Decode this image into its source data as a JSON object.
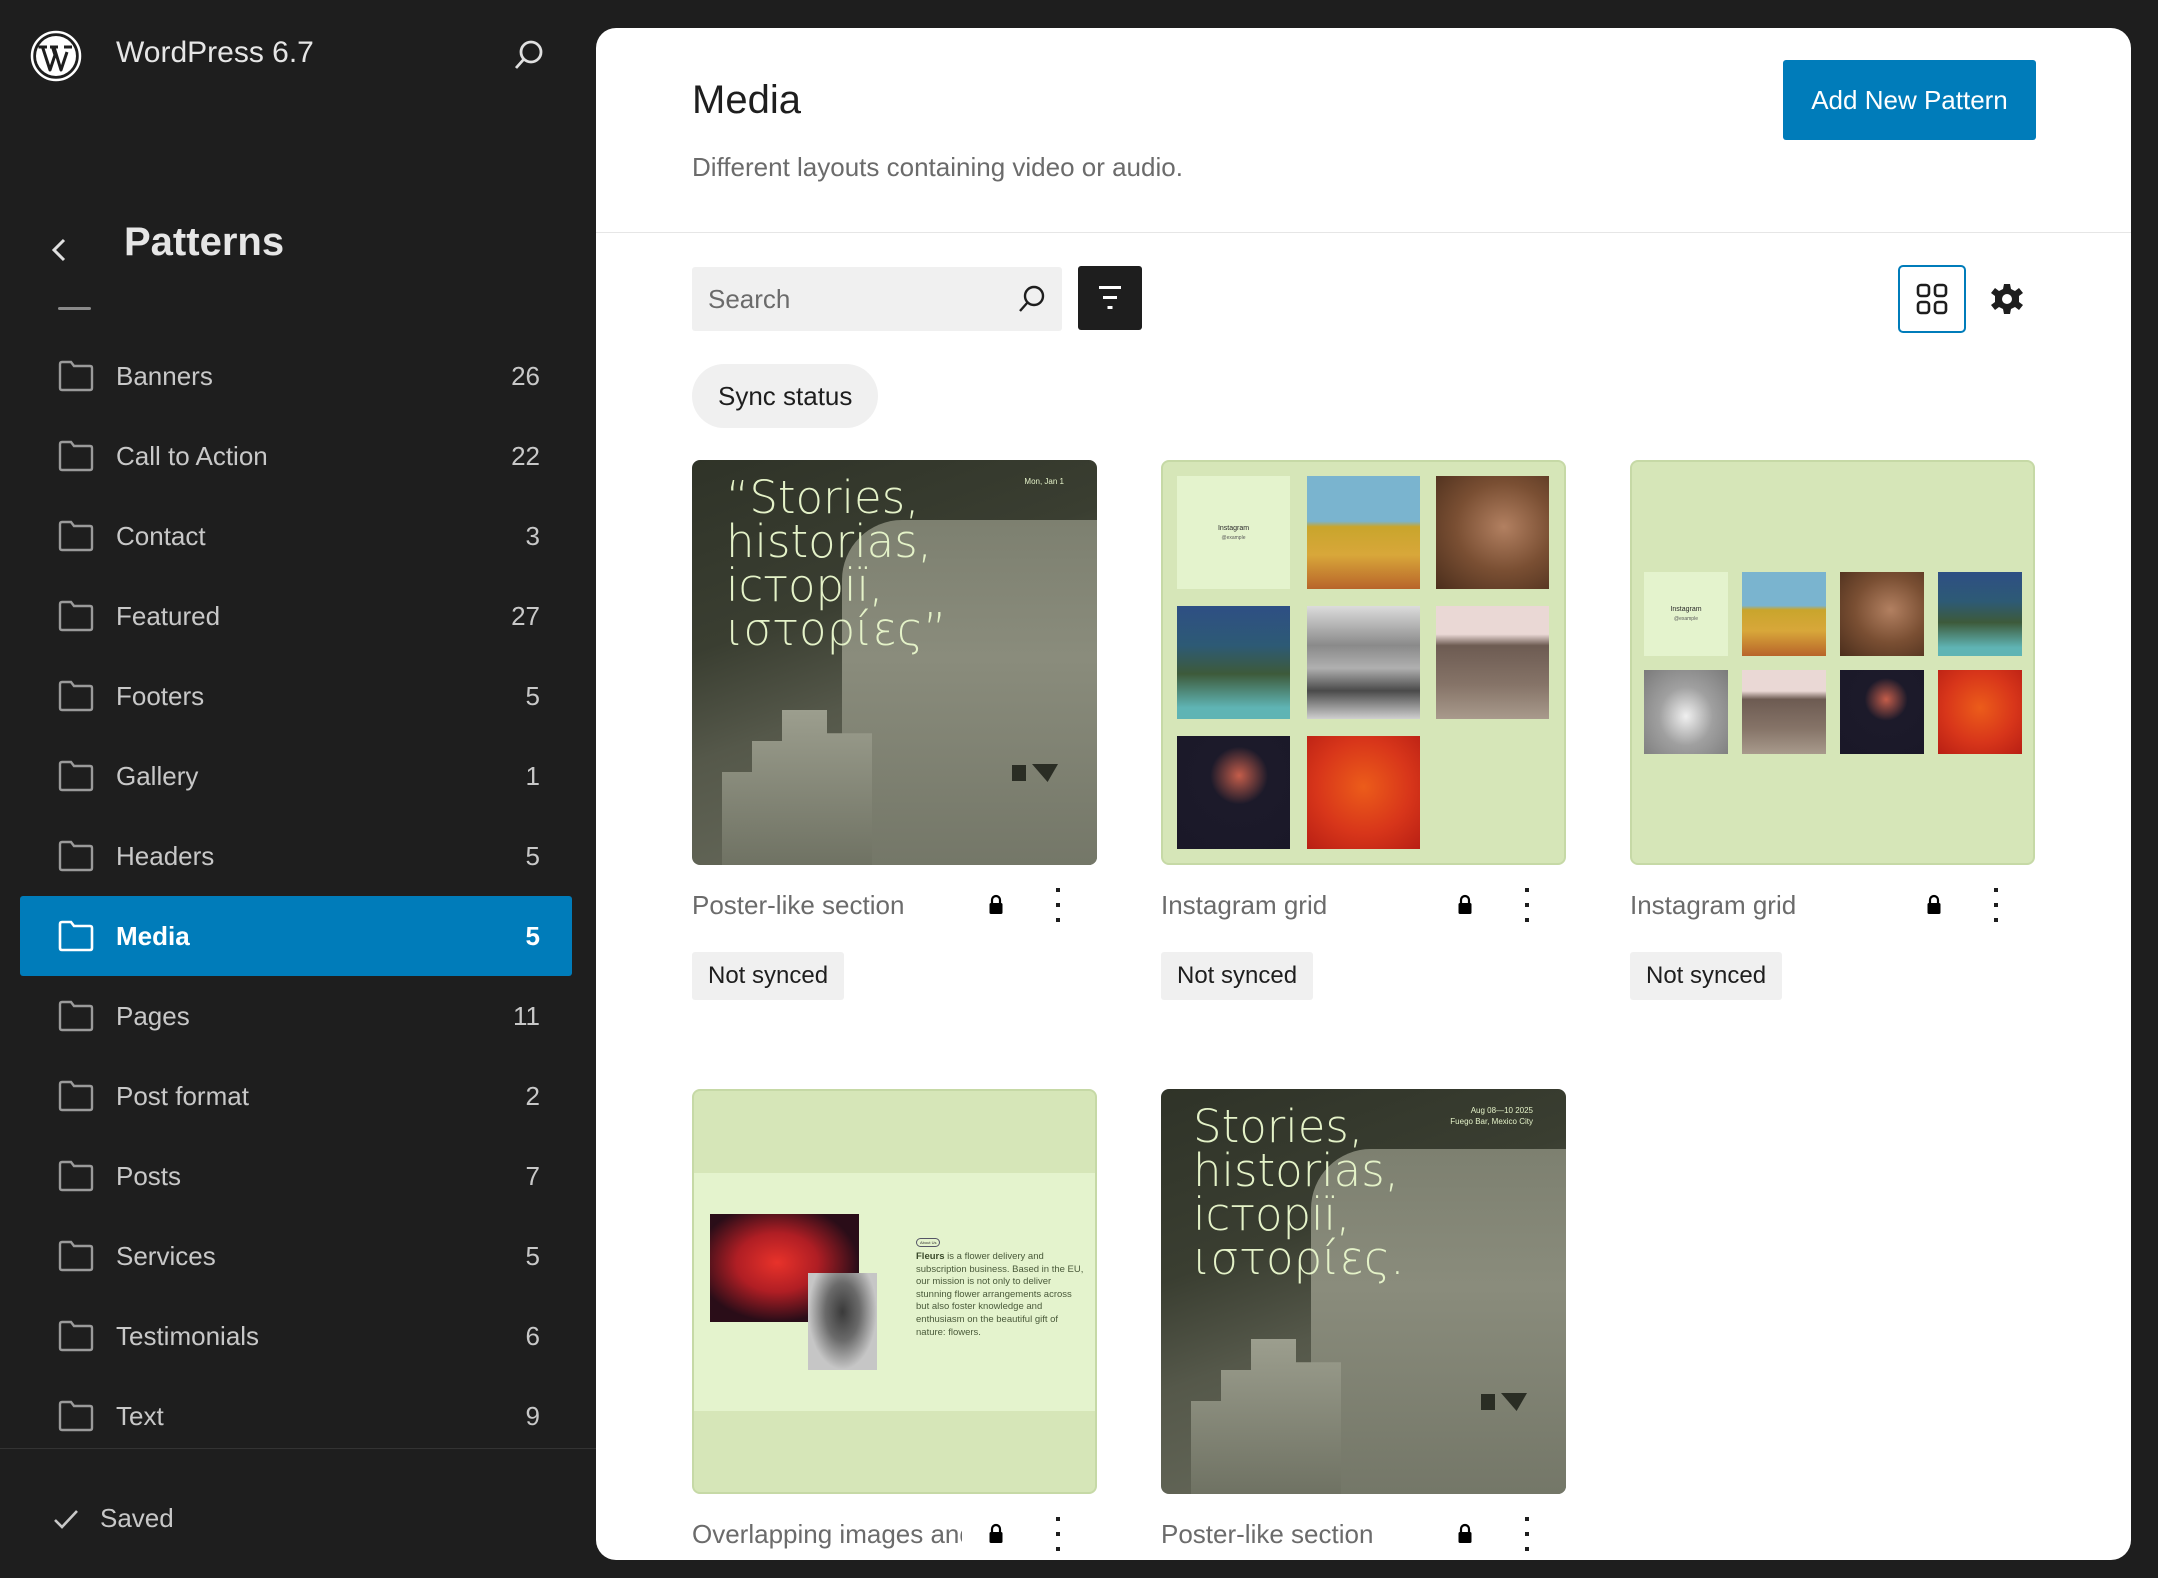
{
  "app": {
    "site_title": "WordPress 6.7",
    "logo": "wordpress-logo",
    "search_icon": "search-icon"
  },
  "sidebar": {
    "title": "Patterns",
    "back_icon": "chevron-left-icon",
    "items": [
      {
        "label": "Banners",
        "count": "26",
        "active": false
      },
      {
        "label": "Call to Action",
        "count": "22",
        "active": false
      },
      {
        "label": "Contact",
        "count": "3",
        "active": false
      },
      {
        "label": "Featured",
        "count": "27",
        "active": false
      },
      {
        "label": "Footers",
        "count": "5",
        "active": false
      },
      {
        "label": "Gallery",
        "count": "1",
        "active": false
      },
      {
        "label": "Headers",
        "count": "5",
        "active": false
      },
      {
        "label": "Media",
        "count": "5",
        "active": true
      },
      {
        "label": "Pages",
        "count": "11",
        "active": false
      },
      {
        "label": "Post format",
        "count": "2",
        "active": false
      },
      {
        "label": "Posts",
        "count": "7",
        "active": false
      },
      {
        "label": "Services",
        "count": "5",
        "active": false
      },
      {
        "label": "Testimonials",
        "count": "6",
        "active": false
      },
      {
        "label": "Text",
        "count": "9",
        "active": false
      }
    ],
    "footer": {
      "status": "Saved",
      "icon": "check-icon"
    }
  },
  "main": {
    "title": "Media",
    "description": "Different layouts containing video or audio.",
    "add_button": "Add New Pattern",
    "search": {
      "placeholder": "Search",
      "value": ""
    },
    "filter_icon": "funnel-icon",
    "view_icon": "grid-view-icon",
    "settings_icon": "gear-icon",
    "filter_chip": "Sync status",
    "patterns": [
      {
        "title": "Poster-like section",
        "badge": "Not synced",
        "locked": true,
        "preview": {
          "type": "poster",
          "heading": "“Stories, historias, історії, ιστορίες”",
          "lines": [
            "“Stories,",
            "historias,",
            "історії,",
            "ιστορίες”"
          ],
          "meta": [
            "Mon, Jan 1"
          ]
        }
      },
      {
        "title": "Instagram grid",
        "badge": "Not synced",
        "locked": true,
        "preview": {
          "type": "instagram-3col",
          "label": "Instagram",
          "handle": "@example"
        }
      },
      {
        "title": "Instagram grid",
        "badge": "Not synced",
        "locked": true,
        "preview": {
          "type": "instagram-4col",
          "label": "Instagram",
          "handle": "@example"
        }
      },
      {
        "title": "Overlapping images and paragraph on solid color background",
        "title_visible": "Overlapping images a",
        "locked": true,
        "preview": {
          "type": "overlapping",
          "pill": "About Us",
          "brand": "Fleurs",
          "text": " is a flower delivery and subscription business. Based in the EU, our mission is not only to deliver stunning flower arrangements across but also foster knowledge and enthusiasm on the beautiful gift of nature: flowers."
        }
      },
      {
        "title": "Poster-like section",
        "locked": true,
        "preview": {
          "type": "poster",
          "lines": [
            "Stories,",
            "historias,",
            "історії,",
            "ιστορίες."
          ],
          "meta": [
            "Aug 08—10 2025",
            "Fuego Bar, Mexico City"
          ]
        }
      }
    ]
  },
  "colors": {
    "accent": "#007cba",
    "sidebar_bg": "#1e1e1e",
    "panel_bg": "#ffffff",
    "chip_bg": "#f0f0f0",
    "preview_green": "#d6e6b8",
    "poster_text": "#e4f2c8"
  }
}
